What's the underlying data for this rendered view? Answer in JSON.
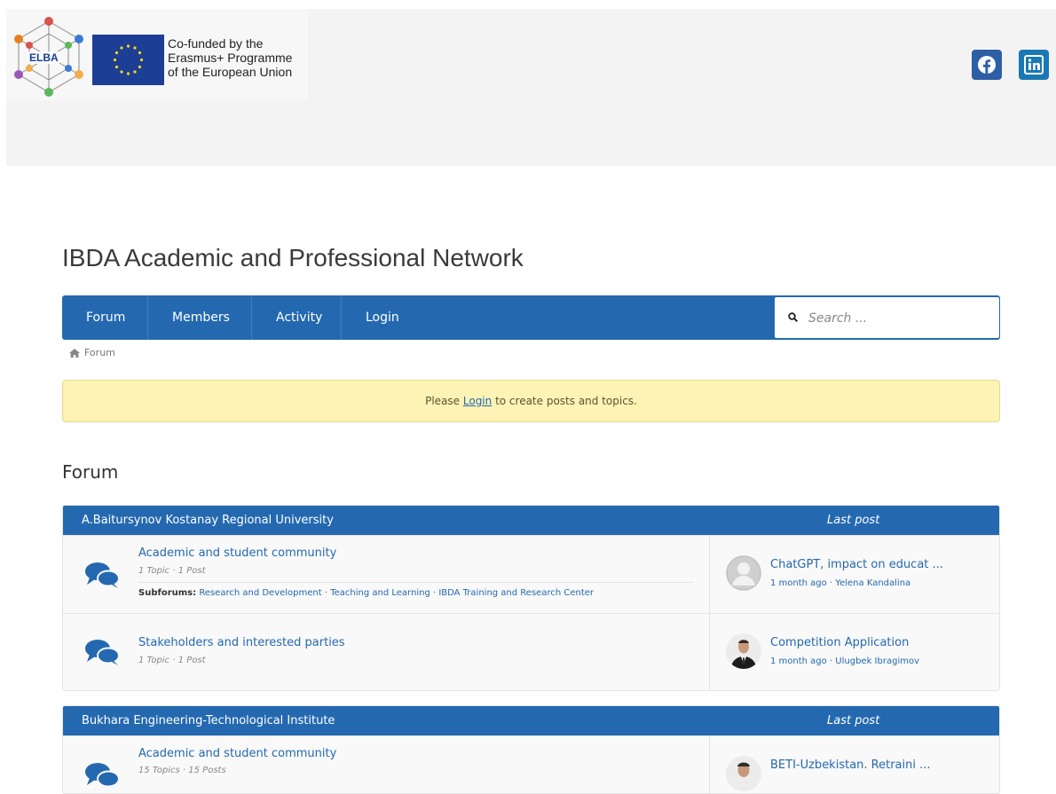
{
  "banner": {
    "logo_text": "ELBA",
    "eu_lines": [
      "Co-funded by the",
      "Erasmus+ Programme",
      "of the European Union"
    ],
    "social": [
      "facebook-icon",
      "linkedin-icon"
    ],
    "colors": {
      "facebook": "#2d5fa5",
      "linkedin": "#1a78b5",
      "eu_flag": "#1c3f95"
    }
  },
  "site": {
    "title": "IBDA Academic and Professional Network"
  },
  "nav": {
    "items": [
      "Forum",
      "Members",
      "Activity",
      "Login"
    ],
    "search_placeholder": "Search ...",
    "color": "#2469b0"
  },
  "breadcrumb": {
    "home_label": "Forum"
  },
  "notice": {
    "before": "Please ",
    "link": "Login",
    "after": " to create posts and topics."
  },
  "forum": {
    "heading": "Forum"
  },
  "categories": [
    {
      "name": "A.Baitursynov Kostanay Regional University",
      "last_post_label": "Last post",
      "forums": [
        {
          "title": "Academic and student community",
          "meta": "1 Topic · 1 Post",
          "subforums_label": "Subforums:",
          "subforums": "Research and Development · Teaching and Learning · IBDA Training and Research Center",
          "last_post": {
            "title": "ChatGPT, impact on educat ...",
            "meta": "1 month ago · Yelena Kandalina"
          }
        },
        {
          "title": "Stakeholders and interested parties",
          "meta": "1 Topic · 1 Post",
          "last_post": {
            "title": "Competition Application",
            "meta": "1 month ago · Ulugbek Ibragimov"
          }
        }
      ]
    },
    {
      "name": "Bukhara Engineering-Technological Institute",
      "last_post_label": "Last post",
      "forums": [
        {
          "title": "Academic and student community",
          "meta": "15 Topics · 15 Posts",
          "last_post": {
            "title": "BETI-Uzbekistan. Retraini ..."
          }
        }
      ]
    }
  ]
}
